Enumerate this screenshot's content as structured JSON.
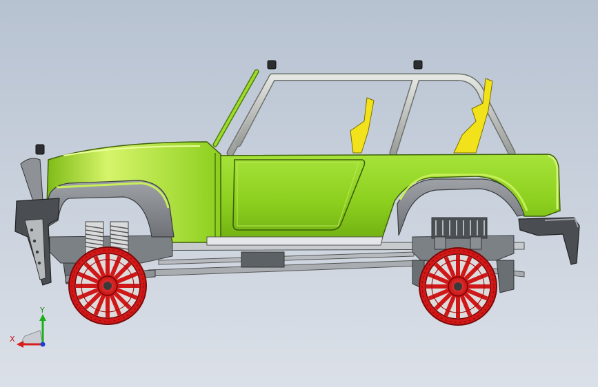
{
  "viewport": {
    "background_top": "#b9c3d2",
    "background_bottom": "#d8dee8"
  },
  "model": {
    "body_color": "#8fd21f",
    "body_highlight": "#c8ef5a",
    "body_shadow": "#5f9410",
    "fender_color": "#8b8f94",
    "chassis_color": "#6f747a",
    "rollcage_color": "#c9ccc8",
    "seat_color": "#f2e21b",
    "wheel_color": "#e02020",
    "tire_color": "#d7d7d7"
  },
  "triad": {
    "x_label": "X",
    "y_label": "Y",
    "x_color": "#d81b1b",
    "y_color": "#1bb01b",
    "z_color": "#1b3fd8"
  }
}
